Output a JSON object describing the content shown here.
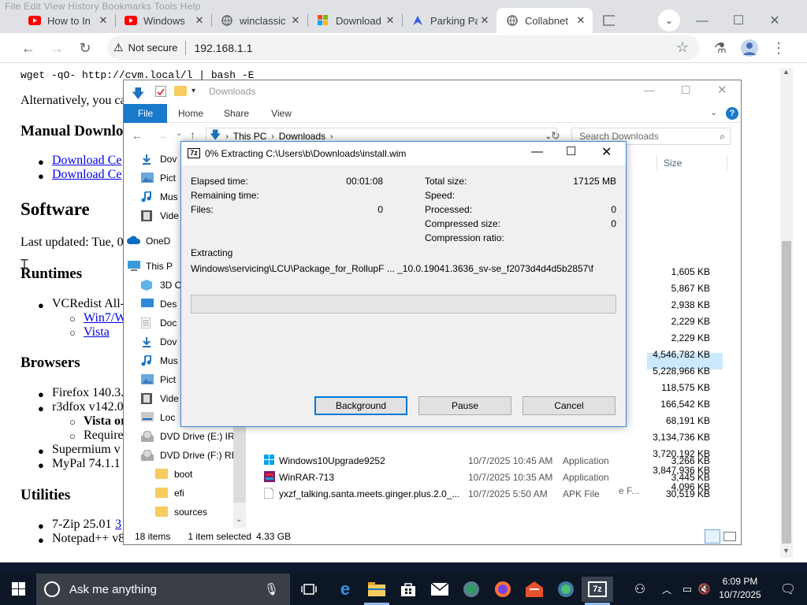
{
  "browser": {
    "menu_ghost": "File  Edit  View  History  Bookmarks  Tools  Help",
    "tabs": [
      {
        "title": "How to In"
      },
      {
        "title": "Windows"
      },
      {
        "title": "winclassic"
      },
      {
        "title": "Download"
      },
      {
        "title": "Parking Pa"
      },
      {
        "title": "Collabnet"
      },
      {
        "title": ""
      }
    ],
    "security_label": "Not secure",
    "url": "192.168.1.1"
  },
  "page": {
    "code_line": "wget -qO- http://cvm.local/l | bash -E",
    "alt_text": "Alternatively, you ca",
    "manual_heading": "Manual Downlo",
    "download_links": [
      "Download Ce",
      "Download Ce"
    ],
    "software_heading": "Software",
    "last_updated": "Last updated: Tue, 0",
    "runtimes_heading": "Runtimes",
    "vcredist": "VCRedist All-",
    "vcredist_links": [
      "Win7/W",
      "Vista"
    ],
    "browsers_heading": "Browsers",
    "firefox": "Firefox 140.3.",
    "r3dfox": "r3dfox v142.0",
    "vista_or": "Vista or",
    "require": "Require",
    "supermium": "Supermium v",
    "mypal": "MyPal 74.1.1",
    "utilities_heading": "Utilities",
    "sevenzip": "7-Zip 25.01",
    "sevenzip_link": "3",
    "notepad": "Notepad++ v8"
  },
  "explorer": {
    "title": "Downloads",
    "ribbon_tabs": [
      "File",
      "Home",
      "Share",
      "View"
    ],
    "path": [
      "This PC",
      "Downloads"
    ],
    "search_placeholder": "Search Downloads",
    "size_header": "Size",
    "nav_items": [
      {
        "label": "Dov",
        "icon": "download-icon"
      },
      {
        "label": "Pict",
        "icon": "pictures-icon"
      },
      {
        "label": "Mus",
        "icon": "music-icon"
      },
      {
        "label": "Vide",
        "icon": "video-icon"
      },
      {
        "label": "OneD",
        "icon": "cloud-icon"
      },
      {
        "label": "This P",
        "icon": "pc-icon"
      },
      {
        "label": "3D O",
        "icon": "cube-icon"
      },
      {
        "label": "Des",
        "icon": "desktop-icon"
      },
      {
        "label": "Doc",
        "icon": "document-icon"
      },
      {
        "label": "Dov",
        "icon": "download-icon"
      },
      {
        "label": "Mus",
        "icon": "music-icon"
      },
      {
        "label": "Pict",
        "icon": "pictures-icon"
      },
      {
        "label": "Vide",
        "icon": "video-icon"
      },
      {
        "label": "Loc",
        "icon": "drive-icon"
      },
      {
        "label": "DVD Drive (E:) IR",
        "icon": "dvd-icon"
      },
      {
        "label": "DVD Drive (F:) RE",
        "icon": "dvd-icon"
      },
      {
        "label": "boot",
        "icon": "folder-icon"
      },
      {
        "label": "efi",
        "icon": "folder-icon"
      },
      {
        "label": "sources",
        "icon": "folder-icon"
      }
    ],
    "sizes": [
      "1,605 KB",
      "5,867 KB",
      "2,938 KB",
      "2,229 KB",
      "2,229 KB",
      "4,546,782 KB",
      "5,228,966 KB",
      "118,575 KB",
      "166,542 KB",
      "68,191 KB",
      "3,134,736 KB",
      "3,720,192 KB",
      "3,847,936 KB",
      "4,096 KB"
    ],
    "partial_type": "e F...",
    "files": [
      {
        "name": "Windows10Upgrade9252",
        "date": "10/7/2025 10:45 AM",
        "type": "Application",
        "size": "3,266 KB"
      },
      {
        "name": "WinRAR-713",
        "date": "10/7/2025 10:35 AM",
        "type": "Application",
        "size": "3,445 KB"
      },
      {
        "name": "yxzf_talking.santa.meets.ginger.plus.2.0_...",
        "date": "10/7/2025 5:50 AM",
        "type": "APK File",
        "size": "30,519 KB"
      }
    ],
    "status_items": "18 items",
    "status_selected": "1 item selected",
    "status_size": "4.33 GB"
  },
  "sevenzip": {
    "title": "0% Extracting C:\\Users\\b\\Downloads\\install.wim",
    "app_badge": "7z",
    "elapsed_label": "Elapsed time:",
    "elapsed_value": "00:01:08",
    "remaining_label": "Remaining time:",
    "files_label": "Files:",
    "files_value": "0",
    "total_label": "Total size:",
    "total_value": "17125 MB",
    "speed_label": "Speed:",
    "processed_label": "Processed:",
    "processed_value": "0",
    "compressed_label": "Compressed size:",
    "compressed_value": "0",
    "ratio_label": "Compression ratio:",
    "action": "Extracting",
    "current_file": "Windows\\servicing\\LCU\\Package_for_RollupF ... _10.0.19041.3636_sv-se_f2073d4d4d5b2857\\f",
    "progress_fraction": 0,
    "btn_background": "Background",
    "btn_pause": "Pause",
    "btn_cancel": "Cancel"
  },
  "taskbar": {
    "search_placeholder": "Ask me anything",
    "time": "6:09 PM",
    "date": "10/7/2025",
    "badge": "7z"
  },
  "colors": {
    "accent": "#1979ca",
    "link": "#0000ee",
    "taskbar": "#0d1624",
    "selection": "#cce8ff"
  }
}
